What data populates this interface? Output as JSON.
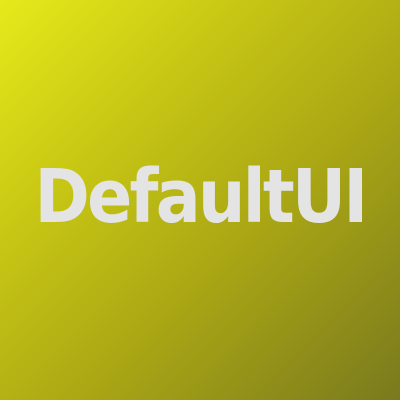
{
  "logo": {
    "text": "DefaultUI"
  },
  "colors": {
    "background_start": "#e6ea1a",
    "background_end": "#7a7a1e",
    "text": "#e4e4e4"
  }
}
